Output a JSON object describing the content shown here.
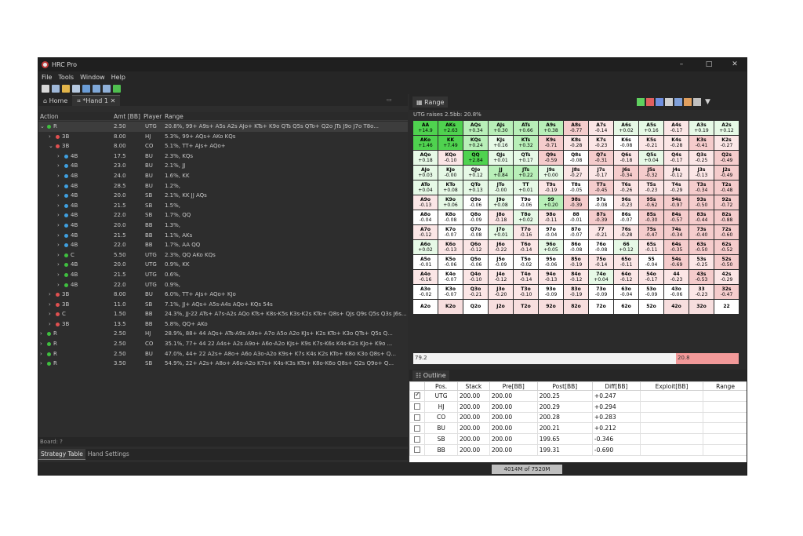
{
  "app": {
    "title": "HRC Pro",
    "min": "–",
    "max": "□",
    "close": "✕"
  },
  "menu": [
    "File",
    "Tools",
    "Window",
    "Help"
  ],
  "tabs": {
    "home": "Home",
    "hand": "*Hand 1"
  },
  "columns": {
    "action": "Action",
    "amt": "Amt [BB]",
    "player": "Player",
    "range": "Range"
  },
  "tree": [
    {
      "chev": "⌄",
      "color": "#3fbf3f",
      "action": "R",
      "amt": "2.50",
      "player": "UTG",
      "range": "20.8%, 99+ A9s+ A5s A2s AJo+ KTs+ K9o QTs Q5s QTo+ Q2o JTs J9o J7o T8o...",
      "indent": 0,
      "sel": true
    },
    {
      "chev": "›",
      "color": "#e05050",
      "action": "3B",
      "amt": "8.00",
      "player": "HJ",
      "range": "5.3%, 99+ AQs+ AKo KQs",
      "indent": 1
    },
    {
      "chev": "⌄",
      "color": "#e05050",
      "action": "3B",
      "amt": "8.00",
      "player": "CO",
      "range": "5.1%, TT+ AJs+ AQo+",
      "indent": 1
    },
    {
      "chev": "›",
      "color": "#3f9fdf",
      "action": "4B",
      "amt": "17.5",
      "player": "BU",
      "range": "2.3%, KQs",
      "indent": 2
    },
    {
      "chev": "›",
      "color": "#3f9fdf",
      "action": "4B",
      "amt": "23.0",
      "player": "BU",
      "range": "2.1%, JJ",
      "indent": 2
    },
    {
      "chev": "›",
      "color": "#3f9fdf",
      "action": "4B",
      "amt": "24.0",
      "player": "BU",
      "range": "1.6%, KK",
      "indent": 2
    },
    {
      "chev": "›",
      "color": "#3f9fdf",
      "action": "4B",
      "amt": "28.5",
      "player": "BU",
      "range": "1.2%,",
      "indent": 2
    },
    {
      "chev": "›",
      "color": "#3f9fdf",
      "action": "4B",
      "amt": "20.0",
      "player": "SB",
      "range": "2.1%, KK JJ AQs",
      "indent": 2
    },
    {
      "chev": "›",
      "color": "#3f9fdf",
      "action": "4B",
      "amt": "21.5",
      "player": "SB",
      "range": "1.5%,",
      "indent": 2
    },
    {
      "chev": "›",
      "color": "#3f9fdf",
      "action": "4B",
      "amt": "22.0",
      "player": "SB",
      "range": "1.7%, QQ",
      "indent": 2
    },
    {
      "chev": "›",
      "color": "#3f9fdf",
      "action": "4B",
      "amt": "20.0",
      "player": "BB",
      "range": "1.3%,",
      "indent": 2
    },
    {
      "chev": "›",
      "color": "#3f9fdf",
      "action": "4B",
      "amt": "21.5",
      "player": "BB",
      "range": "1.1%, AKs",
      "indent": 2
    },
    {
      "chev": "›",
      "color": "#3f9fdf",
      "action": "4B",
      "amt": "22.0",
      "player": "BB",
      "range": "1.7%, AA QQ",
      "indent": 2
    },
    {
      "chev": "›",
      "color": "#3fbf3f",
      "action": "C",
      "amt": "5.50",
      "player": "UTG",
      "range": "2.3%, QQ AKo KQs",
      "indent": 2
    },
    {
      "chev": "›",
      "color": "#3fbf3f",
      "action": "4B",
      "amt": "20.0",
      "player": "UTG",
      "range": "0.9%, KK",
      "indent": 2
    },
    {
      "chev": "›",
      "color": "#3fbf3f",
      "action": "4B",
      "amt": "21.5",
      "player": "UTG",
      "range": "0.6%,",
      "indent": 2
    },
    {
      "chev": "›",
      "color": "#3fbf3f",
      "action": "4B",
      "amt": "22.0",
      "player": "UTG",
      "range": "0.9%,",
      "indent": 2
    },
    {
      "chev": "›",
      "color": "#e05050",
      "action": "3B",
      "amt": "8.00",
      "player": "BU",
      "range": "6.0%, TT+ AJs+ AQo+ KJo",
      "indent": 1
    },
    {
      "chev": "›",
      "color": "#e05050",
      "action": "3B",
      "amt": "11.0",
      "player": "SB",
      "range": "7.1%, JJ+ AQs+ A5s-A4s AQo+ KQs 54s",
      "indent": 1
    },
    {
      "chev": "›",
      "color": "#e05050",
      "action": "C",
      "amt": "1.50",
      "player": "BB",
      "range": "24.3%, JJ-22 ATs+ A7s-A2s AQo KTs+ K8s-K5s K3s-K2s KTo+ Q8s+ QJs Q9s Q5s Q3s J6s...",
      "indent": 1
    },
    {
      "chev": "›",
      "color": "#e05050",
      "action": "3B",
      "amt": "13.5",
      "player": "BB",
      "range": "5.8%, QQ+ AKo",
      "indent": 1
    },
    {
      "chev": "›",
      "color": "#3fbf3f",
      "action": "R",
      "amt": "2.50",
      "player": "HJ",
      "range": "28.9%, 88+ 44 AQs+ ATs-A9s A9o+ A7o A5o A2o KJs+ K2s KTo+ K3o QTs+ Q5s Q...",
      "indent": 0
    },
    {
      "chev": "›",
      "color": "#3fbf3f",
      "action": "R",
      "amt": "2.50",
      "player": "CO",
      "range": "35.1%, 77+ 44 22 A4s+ A2s A9o+ A6o-A2o KJs+ K9s K7s-K6s K4s-K2s KJo+ K9o ...",
      "indent": 0
    },
    {
      "chev": "›",
      "color": "#3fbf3f",
      "action": "R",
      "amt": "2.50",
      "player": "BU",
      "range": "47.0%, 44+ 22 A2s+ A8o+ A6o A3o-A2o K9s+ K7s K4s K2s KTo+ K8o K3o Q8s+ Q...",
      "indent": 0
    },
    {
      "chev": "›",
      "color": "#3fbf3f",
      "action": "R",
      "amt": "3.50",
      "player": "SB",
      "range": "54.9%, 22+ A2s+ A8o+ A6o-A2o K7s+ K4s-K3s KTo+ K8o-K6o Q8s+ Q2s Q9o+ Q...",
      "indent": 0
    }
  ],
  "board": "Board: ?",
  "bottom_tabs": [
    "Strategy Table",
    "Hand Settings"
  ],
  "range_tab": "Range",
  "range_title": "UTG raises 2.5bb: 20.8%",
  "grid": [
    [
      [
        "AA",
        "+14.9"
      ],
      [
        "AKs",
        "+2.63"
      ],
      [
        "AQs",
        "+0.34"
      ],
      [
        "AJs",
        "+0.30"
      ],
      [
        "ATs",
        "+0.66"
      ],
      [
        "A9s",
        "+0.38"
      ],
      [
        "A8s",
        "-0.77"
      ],
      [
        "A7s",
        "-0.14"
      ],
      [
        "A6s",
        "+0.02"
      ],
      [
        "A5s",
        "+0.16"
      ],
      [
        "A4s",
        "-0.17"
      ],
      [
        "A3s",
        "+0.19"
      ],
      [
        "A2s",
        "+0.12"
      ]
    ],
    [
      [
        "AKo",
        "+1.46"
      ],
      [
        "KK",
        "+7.49"
      ],
      [
        "KQs",
        "+0.24"
      ],
      [
        "KJs",
        "+0.16"
      ],
      [
        "KTs",
        "+0.32"
      ],
      [
        "K9s",
        "-0.71"
      ],
      [
        "K8s",
        "-0.28"
      ],
      [
        "K7s",
        "-0.23"
      ],
      [
        "K6s",
        "-0.08"
      ],
      [
        "K5s",
        "-0.21"
      ],
      [
        "K4s",
        "-0.28"
      ],
      [
        "K3s",
        "-0.41"
      ],
      [
        "K2s",
        "-0.27"
      ]
    ],
    [
      [
        "AQo",
        "+0.18"
      ],
      [
        "KQo",
        "-0.10"
      ],
      [
        "QQ",
        "+2.84"
      ],
      [
        "QJs",
        "+0.01"
      ],
      [
        "QTs",
        "+0.17"
      ],
      [
        "Q9s",
        "-0.59"
      ],
      [
        "Q8s",
        "-0.08"
      ],
      [
        "Q7s",
        "-0.31"
      ],
      [
        "Q6s",
        "-0.18"
      ],
      [
        "Q5s",
        "+0.04"
      ],
      [
        "Q4s",
        "-0.17"
      ],
      [
        "Q3s",
        "-0.25"
      ],
      [
        "Q2s",
        "-0.49"
      ]
    ],
    [
      [
        "AJo",
        "+0.03"
      ],
      [
        "KJo",
        "-0.00"
      ],
      [
        "QJo",
        "+0.12"
      ],
      [
        "JJ",
        "+0.84"
      ],
      [
        "JTs",
        "+0.22"
      ],
      [
        "J9s",
        "+0.00"
      ],
      [
        "J8s",
        "-0.27"
      ],
      [
        "J7s",
        "-0.17"
      ],
      [
        "J6s",
        "-0.34"
      ],
      [
        "J5s",
        "-0.32"
      ],
      [
        "J4s",
        "-0.12"
      ],
      [
        "J3s",
        "-0.13"
      ],
      [
        "J2s",
        "-0.49"
      ]
    ],
    [
      [
        "ATo",
        "+0.04"
      ],
      [
        "KTo",
        "+0.08"
      ],
      [
        "QTo",
        "+0.13"
      ],
      [
        "JTo",
        "-0.00"
      ],
      [
        "TT",
        "+0.01"
      ],
      [
        "T9s",
        "-0.19"
      ],
      [
        "T8s",
        "-0.05"
      ],
      [
        "T7s",
        "-0.45"
      ],
      [
        "T6s",
        "-0.26"
      ],
      [
        "T5s",
        "-0.23"
      ],
      [
        "T4s",
        "-0.29"
      ],
      [
        "T3s",
        "-0.34"
      ],
      [
        "T2s",
        "-0.48"
      ]
    ],
    [
      [
        "A9o",
        "-0.13"
      ],
      [
        "K9o",
        "+0.06"
      ],
      [
        "Q9o",
        "-0.06"
      ],
      [
        "J9o",
        "+0.08"
      ],
      [
        "T9o",
        "-0.06"
      ],
      [
        "99",
        "+0.20"
      ],
      [
        "98s",
        "-0.39"
      ],
      [
        "97s",
        "-0.08"
      ],
      [
        "96s",
        "-0.23"
      ],
      [
        "95s",
        "-0.62"
      ],
      [
        "94s",
        "-0.97"
      ],
      [
        "93s",
        "-0.50"
      ],
      [
        "92s",
        "-0.72"
      ]
    ],
    [
      [
        "A8o",
        "-0.04"
      ],
      [
        "K8o",
        "-0.08"
      ],
      [
        "Q8o",
        "-0.09"
      ],
      [
        "J8o",
        "-0.18"
      ],
      [
        "T8o",
        "+0.02"
      ],
      [
        "98o",
        "-0.11"
      ],
      [
        "88",
        "-0.01"
      ],
      [
        "87s",
        "-0.39"
      ],
      [
        "86s",
        "-0.07"
      ],
      [
        "85s",
        "-0.30"
      ],
      [
        "84s",
        "-0.57"
      ],
      [
        "83s",
        "-0.44"
      ],
      [
        "82s",
        "-0.88"
      ]
    ],
    [
      [
        "A7o",
        "-0.12"
      ],
      [
        "K7o",
        "-0.07"
      ],
      [
        "Q7o",
        "-0.08"
      ],
      [
        "J7o",
        "+0.01"
      ],
      [
        "T7o",
        "-0.16"
      ],
      [
        "97o",
        "-0.04"
      ],
      [
        "87o",
        "-0.07"
      ],
      [
        "77",
        "-0.21"
      ],
      [
        "76s",
        "-0.28"
      ],
      [
        "75s",
        "-0.47"
      ],
      [
        "74s",
        "-0.34"
      ],
      [
        "73s",
        "-0.40"
      ],
      [
        "72s",
        "-0.60"
      ]
    ],
    [
      [
        "A6o",
        "+0.02"
      ],
      [
        "K6o",
        "-0.13"
      ],
      [
        "Q6o",
        "-0.12"
      ],
      [
        "J6o",
        "-0.22"
      ],
      [
        "T6o",
        "-0.14"
      ],
      [
        "96o",
        "+0.05"
      ],
      [
        "86o",
        "-0.08"
      ],
      [
        "76o",
        "-0.08"
      ],
      [
        "66",
        "+0.12"
      ],
      [
        "65s",
        "-0.11"
      ],
      [
        "64s",
        "-0.35"
      ],
      [
        "63s",
        "-0.50"
      ],
      [
        "62s",
        "-0.52"
      ]
    ],
    [
      [
        "A5o",
        "-0.01"
      ],
      [
        "K5o",
        "-0.06"
      ],
      [
        "Q5o",
        "-0.06"
      ],
      [
        "J5o",
        "-0.09"
      ],
      [
        "T5o",
        "-0.02"
      ],
      [
        "95o",
        "-0.06"
      ],
      [
        "85o",
        "-0.19"
      ],
      [
        "75o",
        "-0.14"
      ],
      [
        "65o",
        "-0.11"
      ],
      [
        "55",
        "-0.04"
      ],
      [
        "54s",
        "-0.69"
      ],
      [
        "53s",
        "-0.25"
      ],
      [
        "52s",
        "-0.50"
      ]
    ],
    [
      [
        "A4o",
        "-0.16"
      ],
      [
        "K4o",
        "-0.07"
      ],
      [
        "Q4o",
        "-0.10"
      ],
      [
        "J4o",
        "-0.12"
      ],
      [
        "T4o",
        "-0.14"
      ],
      [
        "94o",
        "-0.13"
      ],
      [
        "84o",
        "-0.12"
      ],
      [
        "74o",
        "+0.04"
      ],
      [
        "64o",
        "-0.12"
      ],
      [
        "54o",
        "-0.17"
      ],
      [
        "44",
        "-0.23"
      ],
      [
        "43s",
        "-0.53"
      ],
      [
        "42s",
        "-0.29"
      ]
    ],
    [
      [
        "A3o",
        "-0.02"
      ],
      [
        "K3o",
        "-0.07"
      ],
      [
        "Q3o",
        "-0.21"
      ],
      [
        "J3o",
        "-0.20"
      ],
      [
        "T3o",
        "-0.10"
      ],
      [
        "93o",
        "-0.09"
      ],
      [
        "83o",
        "-0.19"
      ],
      [
        "73o",
        "-0.09"
      ],
      [
        "63o",
        "-0.04"
      ],
      [
        "53o",
        "-0.09"
      ],
      [
        "43o",
        "-0.06"
      ],
      [
        "33",
        "-0.23"
      ],
      [
        "32s",
        "-0.47"
      ]
    ],
    [
      [
        "A2o",
        ""
      ],
      [
        "K2o",
        ""
      ],
      [
        "Q2o",
        ""
      ],
      [
        "J2o",
        ""
      ],
      [
        "T2o",
        ""
      ],
      [
        "92o",
        ""
      ],
      [
        "82o",
        ""
      ],
      [
        "72o",
        ""
      ],
      [
        "62o",
        ""
      ],
      [
        "52o",
        ""
      ],
      [
        "42o",
        ""
      ],
      [
        "32o",
        ""
      ],
      [
        "22",
        ""
      ]
    ]
  ],
  "range_bar": {
    "fold": "79.2",
    "raise": "20.8"
  },
  "outline_tab": "Outline",
  "outline_cols": [
    "Pos.",
    "Stack",
    "Pre[BB]",
    "Post[BB]",
    "Diff[BB]",
    "Exploit[BB]",
    "Range"
  ],
  "outline_rows": [
    {
      "checked": true,
      "pos": "UTG",
      "stack": "200.00",
      "pre": "200.00",
      "post": "200.25",
      "diff": "+0.247"
    },
    {
      "checked": false,
      "pos": "HJ",
      "stack": "200.00",
      "pre": "200.00",
      "post": "200.29",
      "diff": "+0.294"
    },
    {
      "checked": false,
      "pos": "CO",
      "stack": "200.00",
      "pre": "200.00",
      "post": "200.28",
      "diff": "+0.283"
    },
    {
      "checked": false,
      "pos": "BU",
      "stack": "200.00",
      "pre": "200.00",
      "post": "200.21",
      "diff": "+0.212"
    },
    {
      "checked": false,
      "pos": "SB",
      "stack": "200.00",
      "pre": "200.00",
      "post": "199.65",
      "diff": "-0.346"
    },
    {
      "checked": false,
      "pos": "BB",
      "stack": "200.00",
      "pre": "200.00",
      "post": "199.31",
      "diff": "-0.690"
    }
  ],
  "memory": "4014M of 7520M",
  "colors": {
    "raise_green": "#3fcf3f",
    "fold_pink": "#f6d4d4",
    "mixed_pink": "#f39a9a"
  }
}
